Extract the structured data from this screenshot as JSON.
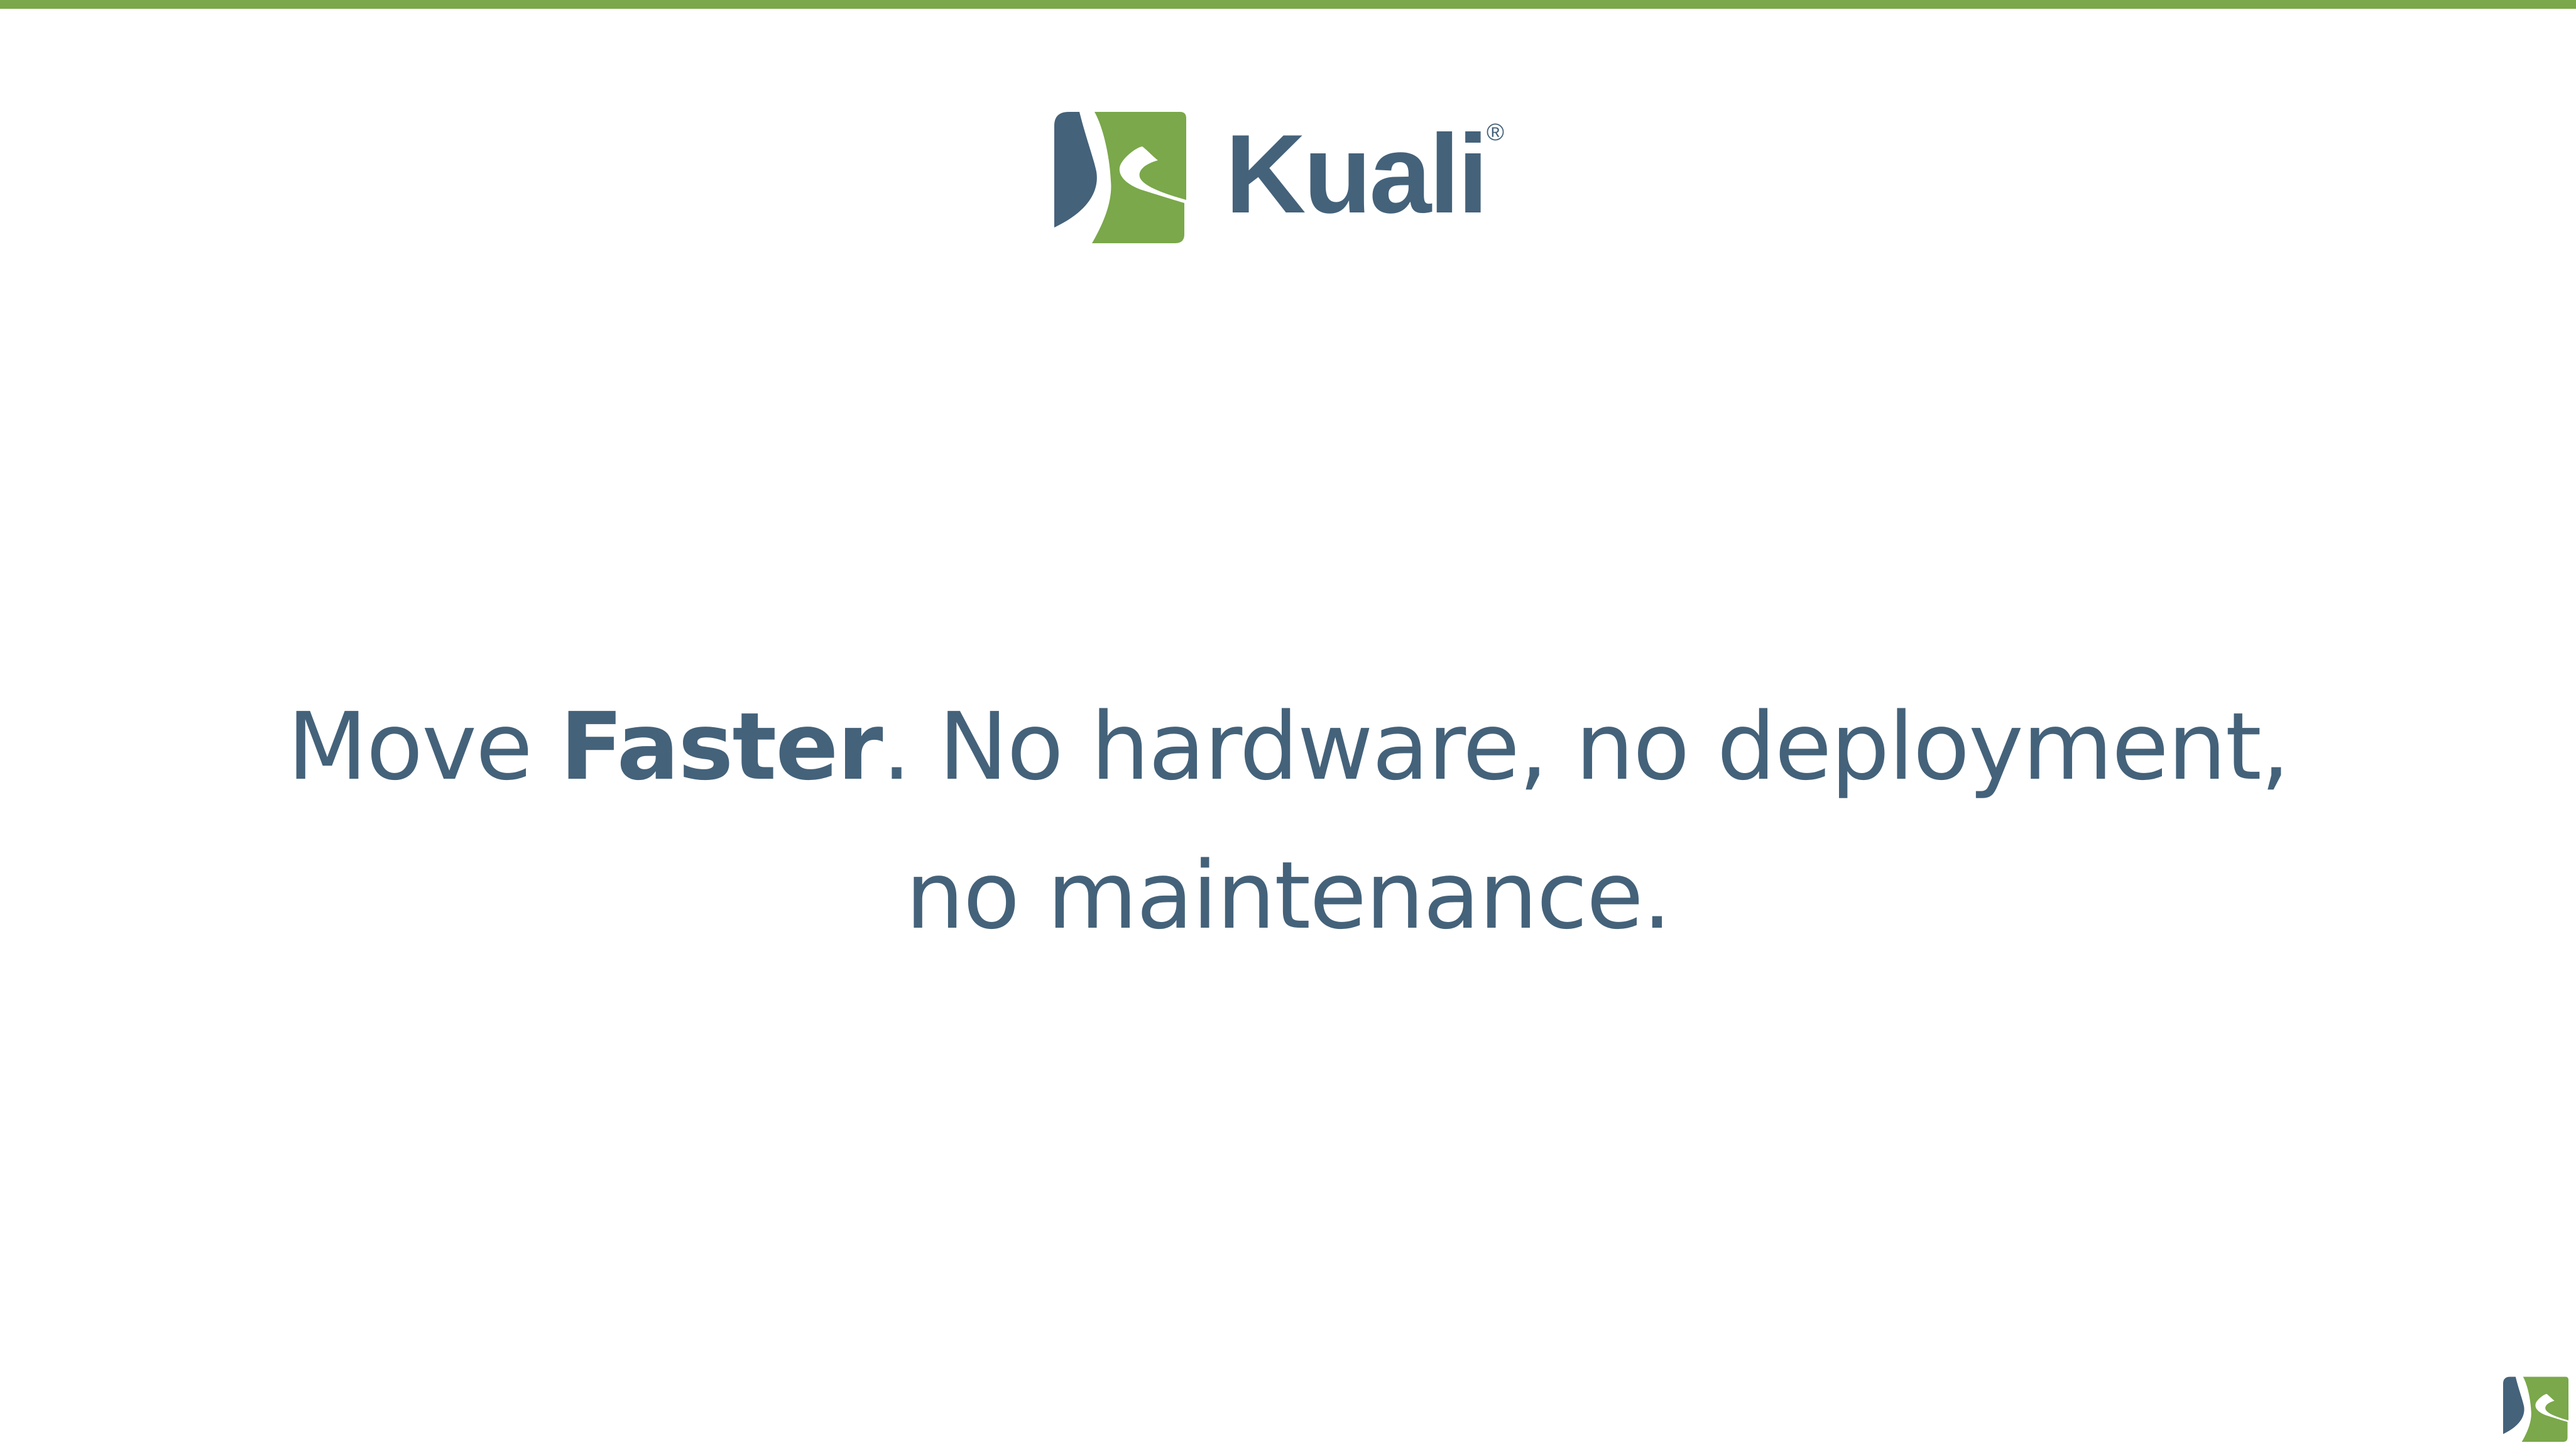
{
  "colors": {
    "brand_blue": "#44627a",
    "brand_green": "#7aa84a",
    "background": "#ffffff"
  },
  "logo": {
    "icon": "kuali-mark-icon",
    "wordmark": "Kuali",
    "registered": "®"
  },
  "headline": {
    "part1": "Move ",
    "emphasis": "Faster",
    "part2": ". No hardware, no deployment,",
    "line2": "no maintenance."
  },
  "footer": {
    "corner_icon": "kuali-mark-icon"
  }
}
